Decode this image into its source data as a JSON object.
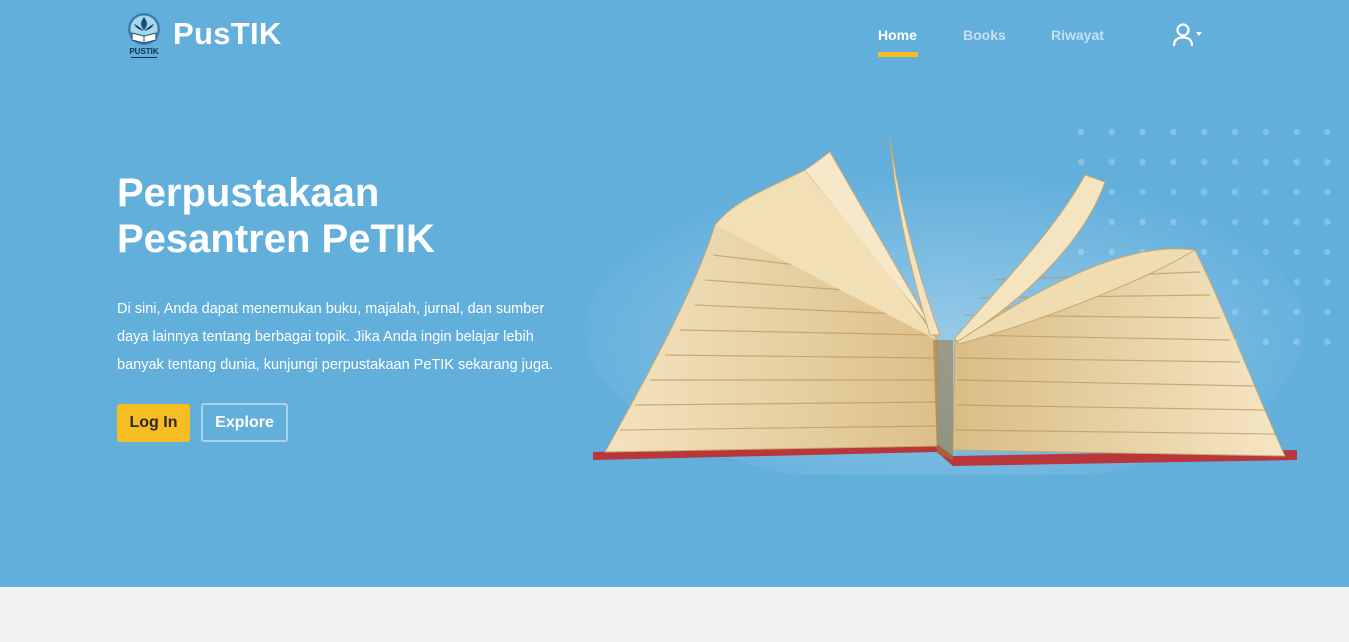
{
  "brand": {
    "name": "PusTIK",
    "logo_text": "PUSTIK"
  },
  "nav": {
    "items": [
      {
        "label": "Home",
        "active": true
      },
      {
        "label": "Books",
        "active": false
      },
      {
        "label": "Riwayat",
        "active": false
      }
    ],
    "user_icon": "user-icon"
  },
  "hero": {
    "title_line1": "Perpustakaan",
    "title_line2": "Pesantren PeTIK",
    "desc_line1": "Di sini, Anda dapat menemukan buku, majalah, jurnal, dan sumber",
    "desc_line2": "daya lainnya tentang berbagai topik. Jika Anda ingin belajar lebih",
    "desc_line3": "banyak tentang dunia, kunjungi perpustakaan PeTIK sekarang juga.",
    "login_label": "Log In",
    "explore_label": "Explore"
  },
  "colors": {
    "hero_bg": "#62afdc",
    "accent": "#f7bd23",
    "page_bg": "#f1f2f1"
  }
}
